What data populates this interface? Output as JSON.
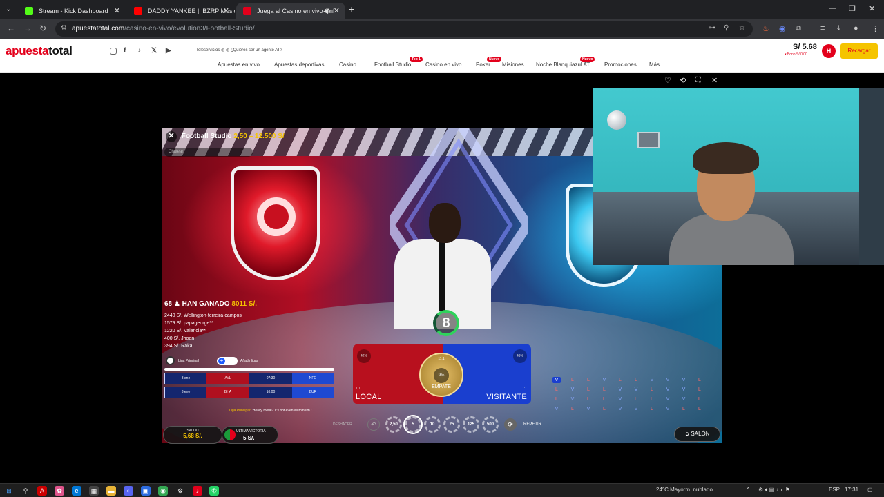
{
  "browser": {
    "tabs": [
      {
        "title": "Stream - Kick Dashboard",
        "favicon_color": "#53fc18"
      },
      {
        "title": "DADDY YANKEE || BZRP Music",
        "favicon_color": "#ff0000"
      },
      {
        "title": "Juega al Casino en vivo Onl",
        "favicon_color": "#e3001b"
      }
    ],
    "new_tab": "+",
    "url_host": "apuestatotal.com",
    "url_path": "/casino-en-vivo/evolution3/Football-Studio/"
  },
  "site": {
    "logo_a": "apuesta",
    "logo_b": "total",
    "social": [
      "◎",
      "f",
      "♪",
      "𝕏",
      "▶"
    ],
    "teleservicios": "Teleservicios ◎ ◎   ¿Quieres ser un agente AT?",
    "nav": [
      {
        "label": "Apuestas en vivo",
        "badge": ""
      },
      {
        "label": "Apuestas deportivas",
        "badge": ""
      },
      {
        "label": "Casino",
        "badge": ""
      },
      {
        "label": "Football Studio",
        "badge": "Top 1"
      },
      {
        "label": "Casino en vivo",
        "badge": ""
      },
      {
        "label": "Poker",
        "badge": "Nuevo"
      },
      {
        "label": "Misiones",
        "badge": ""
      },
      {
        "label": "Noche Blanquiazul AT",
        "badge": "Nuevo"
      },
      {
        "label": "Promociones",
        "badge": ""
      },
      {
        "label": "Más",
        "badge": ""
      }
    ],
    "balance": "S/ 5.68",
    "bonus": "▾ Bono S/ 0.00",
    "avatar_initial": "H",
    "recargar": "Recargar",
    "accent": "#e3001b",
    "yellow": "#f5c400"
  },
  "game": {
    "title": "Football Studio",
    "limits": "2,50 – 12.500 S/",
    "chat_placeholder": "Chatear",
    "timer": "8",
    "winners_count": "68",
    "winners_label": "HAN GANADO",
    "winners_total": "8011 S/.",
    "winners": [
      {
        "amount": "2440 S/.",
        "name": "Wellington-ferreira-campos"
      },
      {
        "amount": "1579 S/.",
        "name": "papageorge**"
      },
      {
        "amount": "1220 S/.",
        "name": "Valencia**"
      },
      {
        "amount": "400 S/.",
        "name": "Jhoan"
      },
      {
        "amount": "394 S/.",
        "name": "Raka"
      }
    ],
    "liga_label": "Liga Principal",
    "liga_add": "Añadir ligas",
    "fixtures": [
      {
        "date": "3 ene",
        "home": "AVL",
        "time": "07:30",
        "away": "NFO"
      },
      {
        "date": "3 ene",
        "home": "BHA",
        "time": "10:00",
        "away": "BUR"
      }
    ],
    "liga_msg_key": "Liga Principal:",
    "liga_msg": "'Heavy metal? It's not even aluminium !",
    "local_label": "LOCAL",
    "local_pct": "42%",
    "local_odds": "1:1",
    "visit_label": "VISITANTE",
    "visit_pct": "49%",
    "visit_odds": "1:1",
    "draw_label": "EMPATE",
    "draw_pct": "9%",
    "draw_odds": "11:1",
    "road_letters": [
      "V",
      "L",
      "L",
      "V",
      "L",
      "L",
      "V",
      "V",
      "V",
      "L",
      "L",
      "V",
      "L",
      "L",
      "V",
      "V",
      "L",
      "V",
      "V",
      "L",
      "L",
      "V",
      "L",
      "L",
      "V",
      "L",
      "L",
      "V",
      "V",
      "L",
      "V",
      "L",
      "V",
      "L",
      "V",
      "V",
      "L",
      "V",
      "L",
      "L"
    ],
    "deshacer": "DESHACER",
    "undo_icon": "↶",
    "chips": [
      {
        "label": "2,50",
        "color": "#d9822b"
      },
      {
        "label": "5",
        "color": "#c9a227"
      },
      {
        "label": "10",
        "color": "#9b3b9a"
      },
      {
        "label": "25",
        "color": "#c0272d"
      },
      {
        "label": "125",
        "color": "#2e8b45"
      },
      {
        "label": "500",
        "color": "#444444"
      }
    ],
    "repeat_icon": "⟳",
    "repetir": "REPETIR",
    "saldo_label": "SALDO",
    "saldo_value": "5,68 S/.",
    "ultima_label": "ULTIMA VICTORIA",
    "ultima_value": "5 S/.",
    "salon": "SALÓN"
  },
  "page_controls": [
    "♡",
    "⟲",
    "⛶",
    "✕"
  ],
  "taskbar": {
    "weather": "24°C  Mayorm. nublado",
    "lang": "ESP",
    "time": "17:31"
  }
}
